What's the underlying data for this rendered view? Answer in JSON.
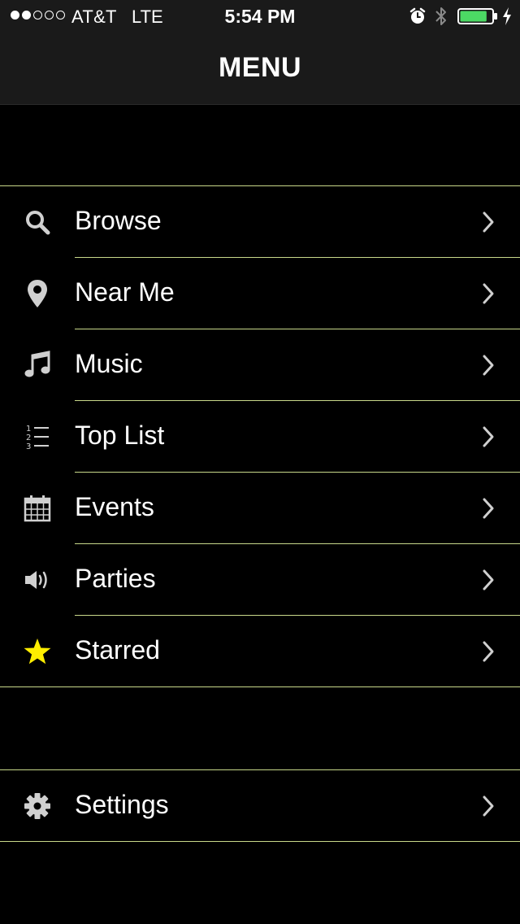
{
  "status_bar": {
    "signal_filled": 2,
    "signal_total": 5,
    "carrier": "AT&T",
    "network": "LTE",
    "time": "5:54 PM",
    "battery_level_fraction": 0.85,
    "battery_color": "#4cd964",
    "icons": [
      "alarm-icon",
      "bluetooth-icon",
      "battery-icon",
      "charging-bolt-icon"
    ]
  },
  "header": {
    "title": "MENU"
  },
  "colors": {
    "background": "#000000",
    "header_background": "#1a1a1a",
    "separator": "#c8d88a",
    "icon": "#d0d0d0",
    "star": "#ffee00"
  },
  "menu": {
    "items": [
      {
        "label": "Browse",
        "icon": "search-icon"
      },
      {
        "label": "Near Me",
        "icon": "map-pin-icon"
      },
      {
        "label": "Music",
        "icon": "music-note-icon"
      },
      {
        "label": "Top List",
        "icon": "numbered-list-icon"
      },
      {
        "label": "Events",
        "icon": "calendar-icon"
      },
      {
        "label": "Parties",
        "icon": "speaker-icon"
      },
      {
        "label": "Starred",
        "icon": "star-icon"
      }
    ]
  },
  "settings": {
    "items": [
      {
        "label": "Settings",
        "icon": "gear-icon"
      }
    ]
  }
}
